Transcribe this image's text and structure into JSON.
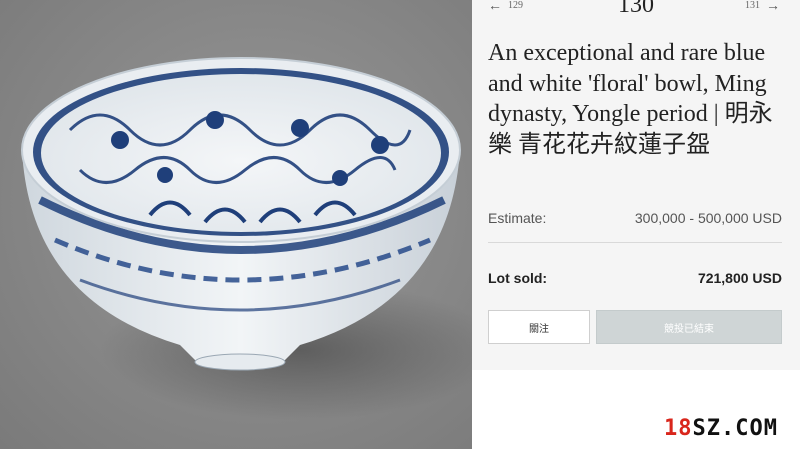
{
  "navigation": {
    "prev_arrow": "←",
    "prev_lot": "129",
    "current_lot": "130",
    "next_lot": "131",
    "next_arrow": "→"
  },
  "lot": {
    "title": "An exceptional and rare blue and white 'floral' bowl, Ming dynasty, Yongle period | 明永樂 青花花卉紋蓮子盌",
    "estimate_label": "Estimate:",
    "estimate_value": "300,000 - 500,000 USD",
    "sold_label": "Lot sold:",
    "sold_value": "721,800 USD"
  },
  "buttons": {
    "follow_label": "關注",
    "bid_label": "競投已結束"
  },
  "watermark": {
    "part1": "18",
    "part2": "SZ.COM"
  },
  "image": {
    "subject": "blue-and-white-porcelain-bowl"
  }
}
